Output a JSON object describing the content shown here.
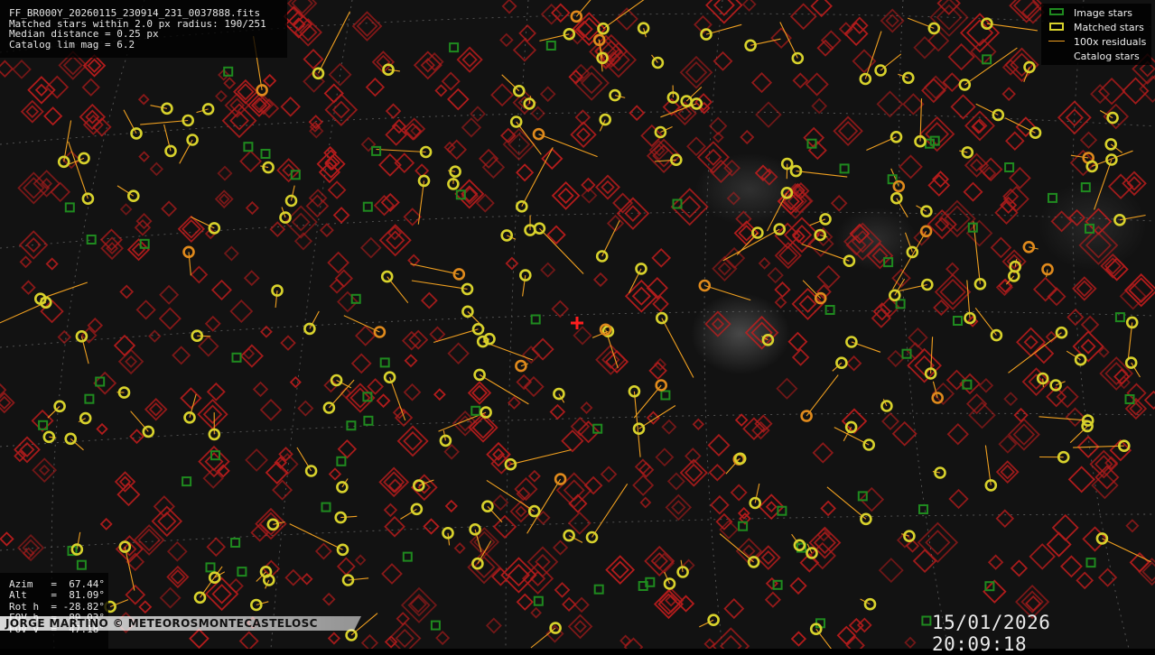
{
  "info": {
    "filename": "FF_BR000Y_20260115_230914_231_0037888.fits",
    "matched": "Matched stars within 2.0 px radius: 190/251",
    "median": "Median distance = 0.25 px",
    "limmag": "Catalog lim mag = 6.2"
  },
  "legend": {
    "image_stars": "Image stars",
    "matched_stars": "Matched stars",
    "residuals": "100x residuals",
    "catalog_stars": "Catalog stars",
    "colors": {
      "image": "#1f8a1f",
      "matched": "#d8d22c",
      "residual": "#f0a020",
      "catalog": "#c81e1e"
    }
  },
  "pointing": {
    "azim": "Azim   =  67.44°",
    "alt": "Alt    =  81.09°",
    "roth": "Rot h  = -28.82°",
    "fovh": "FOV h  =  89.03°",
    "fovv": "FOV v  =  47.18°"
  },
  "watermark": "JORGE MARTINO  ©  METEOROSMONTECASTELOSC",
  "timestamp": "15/01/2026 20:09:18",
  "center_icon": "crosshair-icon"
}
